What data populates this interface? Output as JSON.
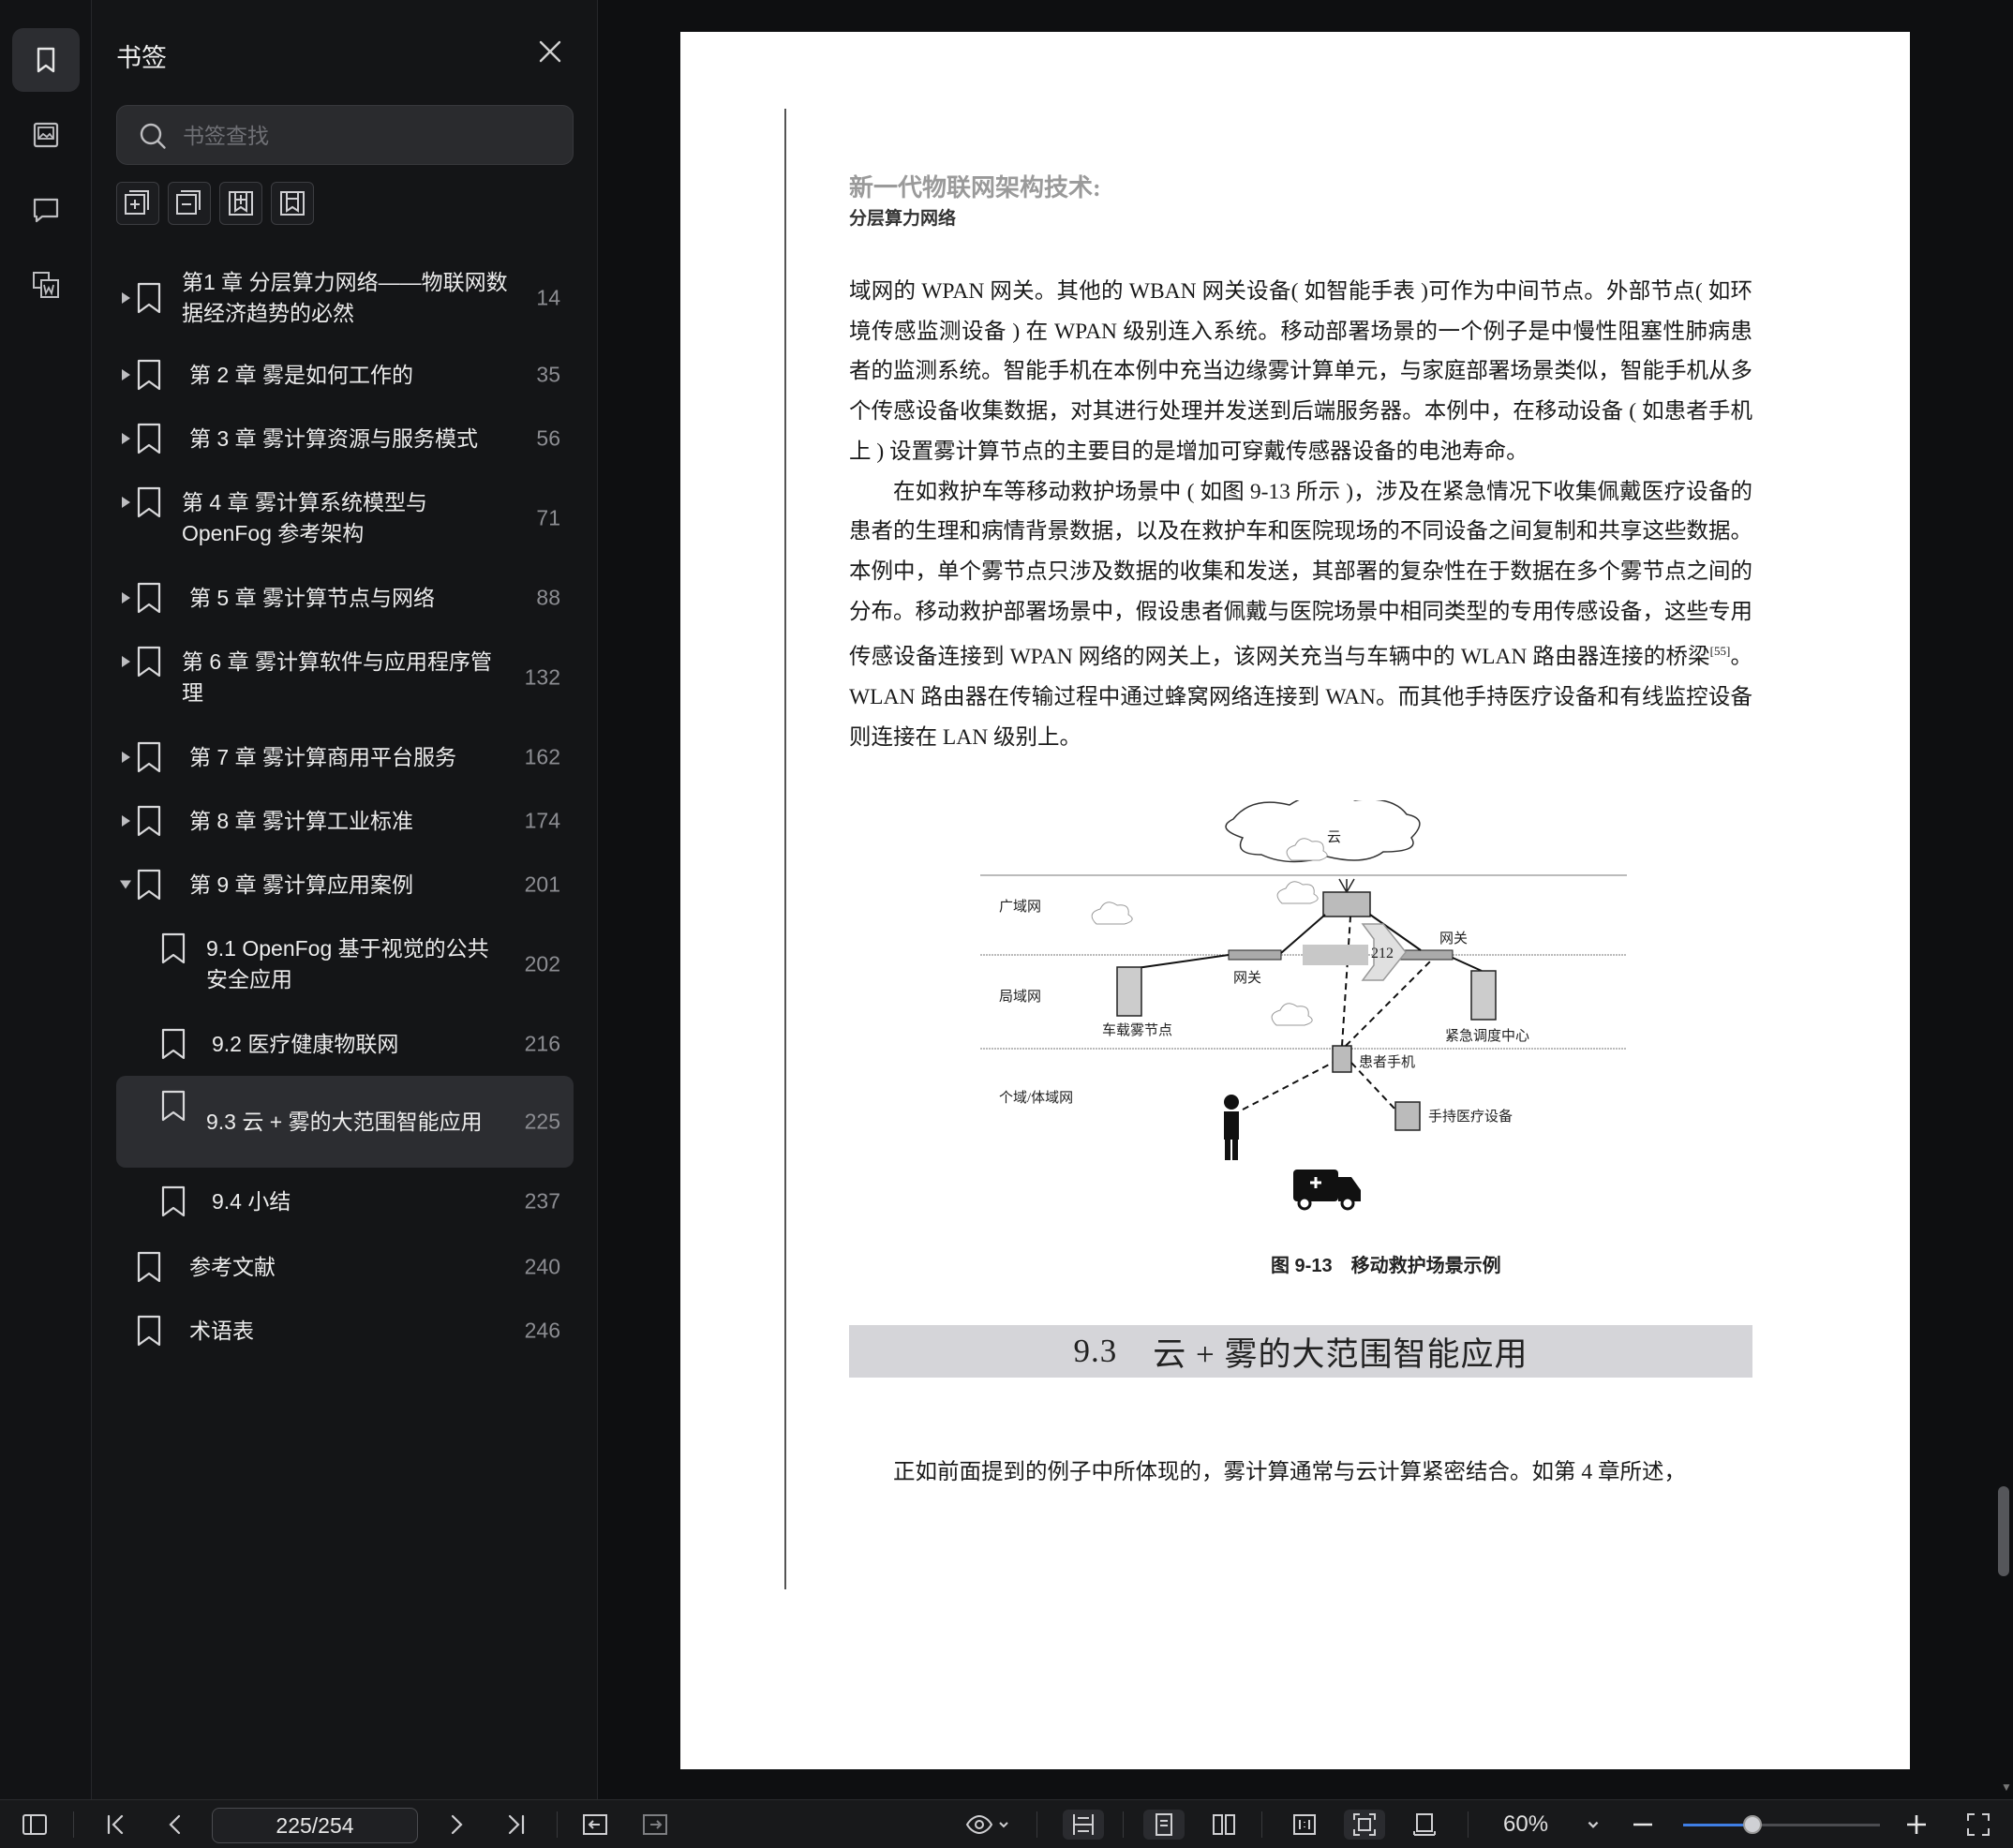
{
  "panel": {
    "title": "书签",
    "search_placeholder": "书签查找"
  },
  "bookmarks": [
    {
      "label": "第1 章 分层算力网络——物联网数据经济趋势的必然",
      "page": "14",
      "level": 0,
      "caret": "right"
    },
    {
      "label": "第 2 章 雾是如何工作的",
      "page": "35",
      "level": 0,
      "caret": "right"
    },
    {
      "label": "第 3 章 雾计算资源与服务模式",
      "page": "56",
      "level": 0,
      "caret": "right"
    },
    {
      "label": "第 4 章 雾计算系统模型与 OpenFog 参考架构",
      "page": "71",
      "level": 0,
      "caret": "right"
    },
    {
      "label": "第 5 章 雾计算节点与网络",
      "page": "88",
      "level": 0,
      "caret": "right"
    },
    {
      "label": "第 6 章 雾计算软件与应用程序管理",
      "page": "132",
      "level": 0,
      "caret": "right"
    },
    {
      "label": "第 7 章 雾计算商用平台服务",
      "page": "162",
      "level": 0,
      "caret": "right"
    },
    {
      "label": "第 8 章 雾计算工业标准",
      "page": "174",
      "level": 0,
      "caret": "right"
    },
    {
      "label": "第 9 章 雾计算应用案例",
      "page": "201",
      "level": 0,
      "caret": "down"
    },
    {
      "label": "9.1 OpenFog 基于视觉的公共安全应用",
      "page": "202",
      "level": 1,
      "caret": "none"
    },
    {
      "label": "9.2 医疗健康物联网",
      "page": "216",
      "level": 1,
      "caret": "none"
    },
    {
      "label": "9.3 云 + 雾的大范围智能应用",
      "page": "225",
      "level": 1,
      "caret": "none",
      "selected": true
    },
    {
      "label": "9.4 小结",
      "page": "237",
      "level": 1,
      "caret": "none"
    },
    {
      "label": "参考文献",
      "page": "240",
      "level": 0,
      "caret": "none"
    },
    {
      "label": "术语表",
      "page": "246",
      "level": 0,
      "caret": "none"
    }
  ],
  "document": {
    "running_title": "新一代物联网架构技术:",
    "running_subtitle": "分层算力网络",
    "page_tag": "212",
    "para1": "域网的 WPAN 网关。其他的 WBAN 网关设备( 如智能手表 )可作为中间节点。外部节点( 如环境传感监测设备 ) 在 WPAN 级别连入系统。移动部署场景的一个例子是中慢性阻塞性肺病患者的监测系统。智能手机在本例中充当边缘雾计算单元，与家庭部署场景类似，智能手机从多个传感设备收集数据，对其进行处理并发送到后端服务器。本例中，在移动设备 ( 如患者手机上 ) 设置雾计算节点的主要目的是增加可穿戴传感器设备的电池寿命。",
    "para2a": "在如救护车等移动救护场景中 ( 如图 9-13 所示 )，涉及在紧急情况下收集佩戴医疗设备的患者的生理和病情背景数据，以及在救护车和医院现场的不同设备之间复制和共享这些数据。本例中，单个雾节点只涉及数据的收集和发送，其部署的复杂性在于数据在多个雾节点之间的分布。移动救护部署场景中，假设患者佩戴与医院场景中相同类型的专用传感设备，这些专用传感设备连接到 WPAN 网络的网关上，该网关充当与车辆中的 WLAN 路由器连接的桥梁",
    "para2_ref": "[55]",
    "para2b": "。WLAN 路由器在传输过程中通过蜂窝网络连接到 WAN。而其他手持医疗设备和有线监控设备则连接在 LAN 级别上。",
    "figure": {
      "cloud": "云",
      "wan": "广域网",
      "lan": "局域网",
      "pan": "个域/体域网",
      "gateway_left": "网关",
      "gateway_right": "网关",
      "vehicle_fog": "车载雾节点",
      "dispatch_center": "紧急调度中心",
      "patient_phone": "患者手机",
      "handheld": "手持医疗设备"
    },
    "caption": "图 9-13　移动救护场景示例",
    "section_number": "9.3",
    "section_title": "云 + 雾的大范围智能应用",
    "para3": "正如前面提到的例子中所体现的，雾计算通常与云计算紧密结合。如第 4 章所述，"
  },
  "toolbar": {
    "page_indicator": "225/254",
    "zoom": "60%",
    "zoom_fraction": 0.35
  }
}
